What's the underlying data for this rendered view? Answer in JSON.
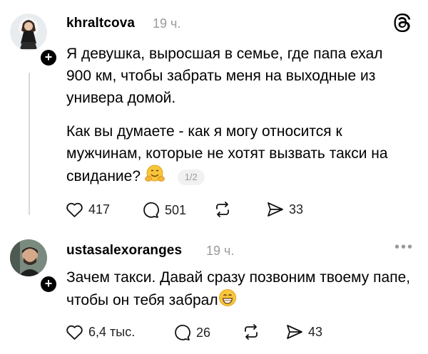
{
  "post1": {
    "username": "khraltcova",
    "time": "19 ч.",
    "paragraph1": "Я девушка, выросшая в семье, где папа ехал 900 км, чтобы забрать меня на выходные из универа домой.",
    "paragraph2": "Как вы думаете - как я могу относится к мужчинам, которые не хотят вызвать такси на свидание?",
    "pager": "1/2",
    "likes": "417",
    "comments": "501",
    "shares": "33"
  },
  "post2": {
    "username": "ustasalexoranges",
    "time": "19 ч.",
    "text": "Зачем такси. Давай сразу позвоним твоему папе, чтобы он тебя забрал",
    "likes": "6,4 тыс.",
    "comments": "26",
    "shares": "43"
  },
  "icons": {
    "threads_logo": "threads-logo-icon",
    "like": "heart-icon",
    "comment": "speech-bubble-icon",
    "repost": "repost-icon",
    "share": "send-icon",
    "emoji1": "hugging-face-emoji",
    "emoji2": "grinning-face-emoji"
  }
}
